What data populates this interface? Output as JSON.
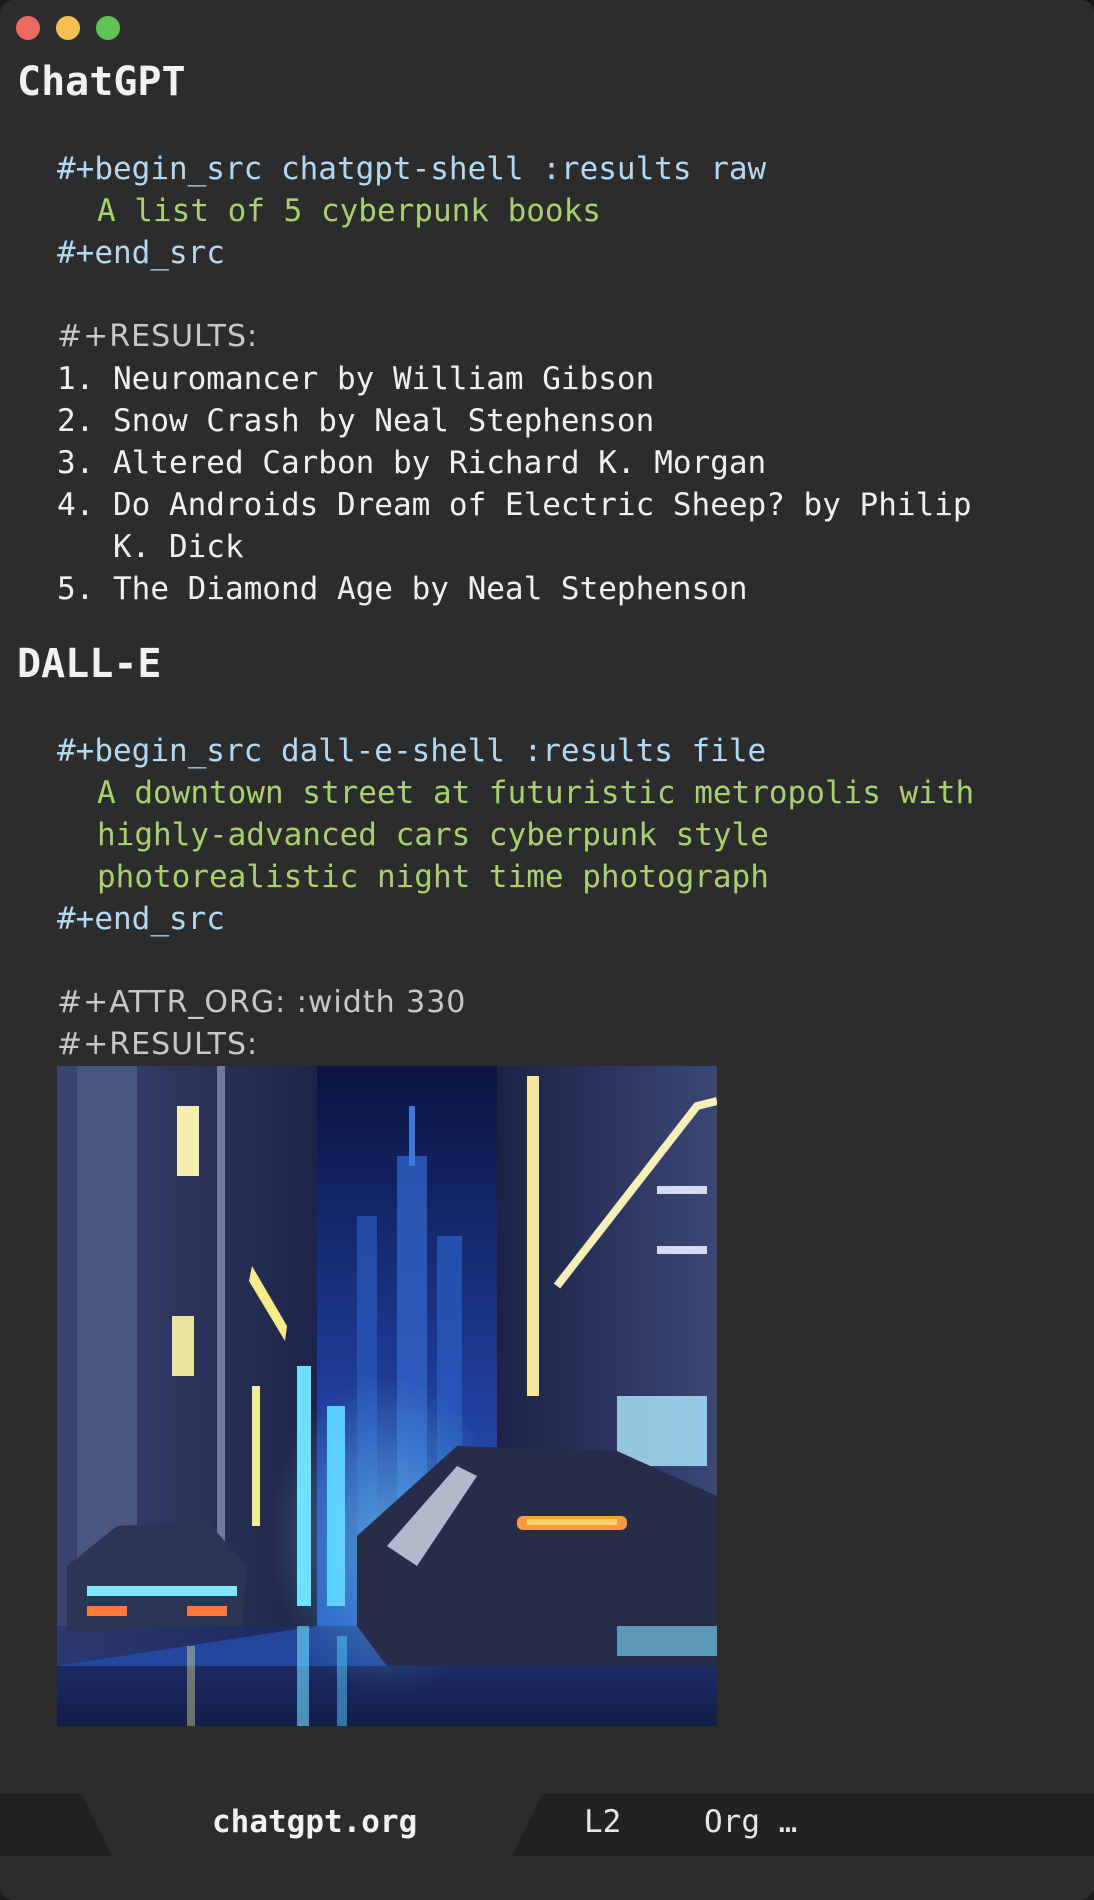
{
  "window": {
    "controls": [
      "close",
      "minimize",
      "zoom"
    ]
  },
  "sections": {
    "chatgpt": {
      "heading": "ChatGPT",
      "begin_src": "#+begin_src chatgpt-shell :results raw",
      "prompt": "A list of 5 cyberpunk books",
      "end_src": "#+end_src",
      "results_label": "#+RESULTS:",
      "results": [
        "1. Neuromancer by William Gibson",
        "2. Snow Crash by Neal Stephenson",
        "3. Altered Carbon by Richard K. Morgan",
        "4. Do Androids Dream of Electric Sheep? by Philip",
        "   K. Dick",
        "5. The Diamond Age by Neal Stephenson"
      ]
    },
    "dalle": {
      "heading": "DALL-E",
      "begin_src": "#+begin_src dall-e-shell :results file",
      "prompt_lines": [
        "A downtown street at futuristic metropolis with",
        "highly-advanced cars cyberpunk style",
        "photorealistic night time photograph"
      ],
      "end_src": "#+end_src",
      "attr_org": "#+ATTR_ORG: :width 330",
      "results_label": "#+RESULTS:",
      "image_description": "cyberpunk-street-image"
    }
  },
  "modeline": {
    "buffer_name": "chatgpt.org",
    "line": "L2",
    "mode": "Org …"
  },
  "colors": {
    "background": "#2c2c2c",
    "keyword": "#b3d9f2",
    "prompt": "#a9cf6f",
    "text": "#f0f0f0"
  }
}
